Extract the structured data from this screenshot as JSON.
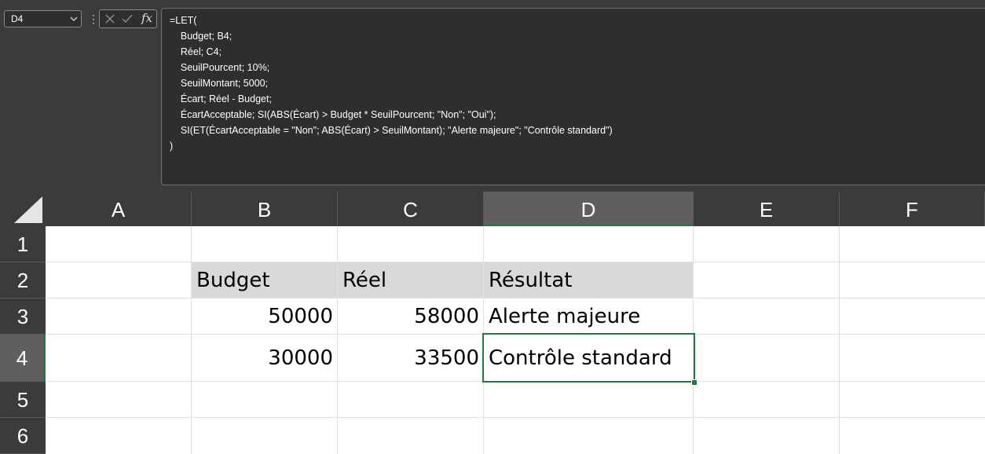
{
  "name_box": {
    "value": "D4"
  },
  "formula_bar": {
    "fx_label": "fx",
    "lines": [
      "=LET(",
      "    Budget; B4;",
      "    Réel; C4;",
      "    SeuilPourcent; 10%;",
      "    SeuilMontant; 5000;",
      "    Écart; Réel - Budget;",
      "    ÉcartAcceptable; SI(ABS(Écart) > Budget * SeuilPourcent; \"Non\"; \"Oui\");",
      "    SI(ET(ÉcartAcceptable = \"Non\"; ABS(Écart) > SeuilMontant); \"Alerte majeure\"; \"Contrôle standard\")",
      ")"
    ]
  },
  "columns": [
    "A",
    "B",
    "C",
    "D",
    "E",
    "F"
  ],
  "rows": [
    "1",
    "2",
    "3",
    "4",
    "5",
    "6"
  ],
  "selected": {
    "column": "D",
    "row": "4"
  },
  "cells": {
    "B2": "Budget",
    "C2": "Réel",
    "D2": "Résultat",
    "B3": "50000",
    "C3": "58000",
    "D3": "Alerte majeure",
    "B4": "30000",
    "C4": "33500",
    "D4": "Contrôle standard"
  },
  "colors": {
    "selection": "#1e7a44",
    "header_fill": "#d9d9d9",
    "chrome": "#3b3b3b"
  }
}
